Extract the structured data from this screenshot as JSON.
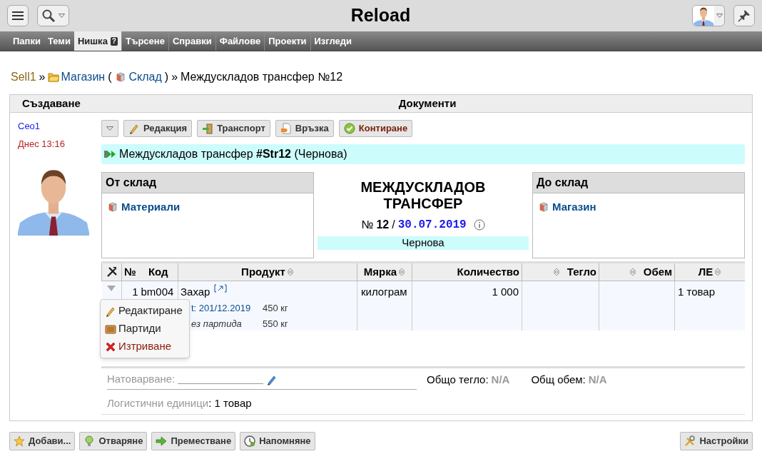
{
  "top_bar": {
    "title": "Reload"
  },
  "nav": [
    {
      "label": "Папки",
      "selected": false
    },
    {
      "label": "Теми",
      "selected": false
    },
    {
      "label": "Нишка",
      "selected": true,
      "badge": "?"
    },
    {
      "label": "Търсене",
      "selected": false
    },
    {
      "label": "Справки",
      "selected": false
    },
    {
      "label": "Файлове",
      "selected": false
    },
    {
      "label": "Проекти",
      "selected": false
    },
    {
      "label": "Изгледи",
      "selected": false
    }
  ],
  "breadcrumb": [
    {
      "text": "Sell1",
      "kind": "root"
    },
    {
      "text": "»",
      "kind": "plain"
    },
    {
      "text": "Магазин",
      "kind": "folder"
    },
    {
      "text": "(",
      "kind": "plain"
    },
    {
      "text": "Склад",
      "kind": "store"
    },
    {
      "text": ")",
      "kind": "plain"
    },
    {
      "text": "»",
      "kind": "plain"
    },
    {
      "text": "Междускладов трансфер №12",
      "kind": "plain"
    }
  ],
  "panel": {
    "left_header": "Създаване",
    "main_header": "Документи"
  },
  "author": {
    "name": "Сео1",
    "time": "Днес 13:16"
  },
  "toolbar": [
    {
      "label": "Редакция",
      "kind": "pencil"
    },
    {
      "label": "Транспорт",
      "kind": "door"
    },
    {
      "label": "Връзка",
      "kind": "link"
    },
    {
      "label": "Контиране",
      "kind": "check"
    }
  ],
  "document_title": "Междускладов трансфер **#Str12** (Чернова)",
  "from_store": {
    "header": "От склад",
    "value": "Материали"
  },
  "doc": {
    "title": "МЕЖДУСКЛАДОВ ТРАНСФЕР",
    "number_sign": "№",
    "number": "12",
    "separator": "/",
    "date": "30.07.2019",
    "state": "Чернова"
  },
  "to_store": {
    "header": "До склад",
    "value": "Магазин"
  },
  "table": {
    "columns": [
      {
        "kind": "tools"
      },
      {
        "label": "№",
        "kind": "plain"
      },
      {
        "label": "Код",
        "kind": "plain"
      },
      {
        "label": "Продукт",
        "kind": "sortable"
      },
      {
        "label": "Мярка",
        "kind": "sortable"
      },
      {
        "label": "Количество",
        "kind": "plain"
      },
      {
        "label": "Тегло",
        "kind": "sortleft"
      },
      {
        "label": "Обем",
        "kind": "sortleft"
      },
      {
        "label": "ЛЕ",
        "kind": "sortable"
      }
    ],
    "rows": [
      {
        "number": "1",
        "code": "bm004",
        "product": "Захар",
        "batches": [
          {
            "name": "t: 201/12.2019",
            "kind": "batch",
            "amount": "450 кг"
          },
          {
            "name": "ез партида",
            "kind": "none",
            "amount": "550 кг"
          }
        ],
        "unit": "килограм",
        "quantity": "1 000",
        "units": "1 товар"
      }
    ]
  },
  "row_menu": [
    {
      "label": "Редактиране",
      "kind": "edit"
    },
    {
      "label": "Партиди",
      "kind": "batches"
    },
    {
      "label": "Изтриване",
      "kind": "delete"
    }
  ],
  "footer": {
    "loading_label": "Натоварване:",
    "units_label": "Логистични единици",
    "units": ": 1 товар",
    "total_weight_label": "Общо тегло:",
    "total_weight": "N/A",
    "total_volume_label": "Общ обем:",
    "total_volume": "N/A"
  },
  "bottom_buttons": [
    {
      "label": "Добави...",
      "kind": "star"
    },
    {
      "label": "Отваряне",
      "kind": "bulb"
    },
    {
      "label": "Преместване",
      "kind": "arrow"
    },
    {
      "label": "Напомняне",
      "kind": "clock"
    }
  ],
  "settings_button": {
    "label": "Настройки"
  }
}
